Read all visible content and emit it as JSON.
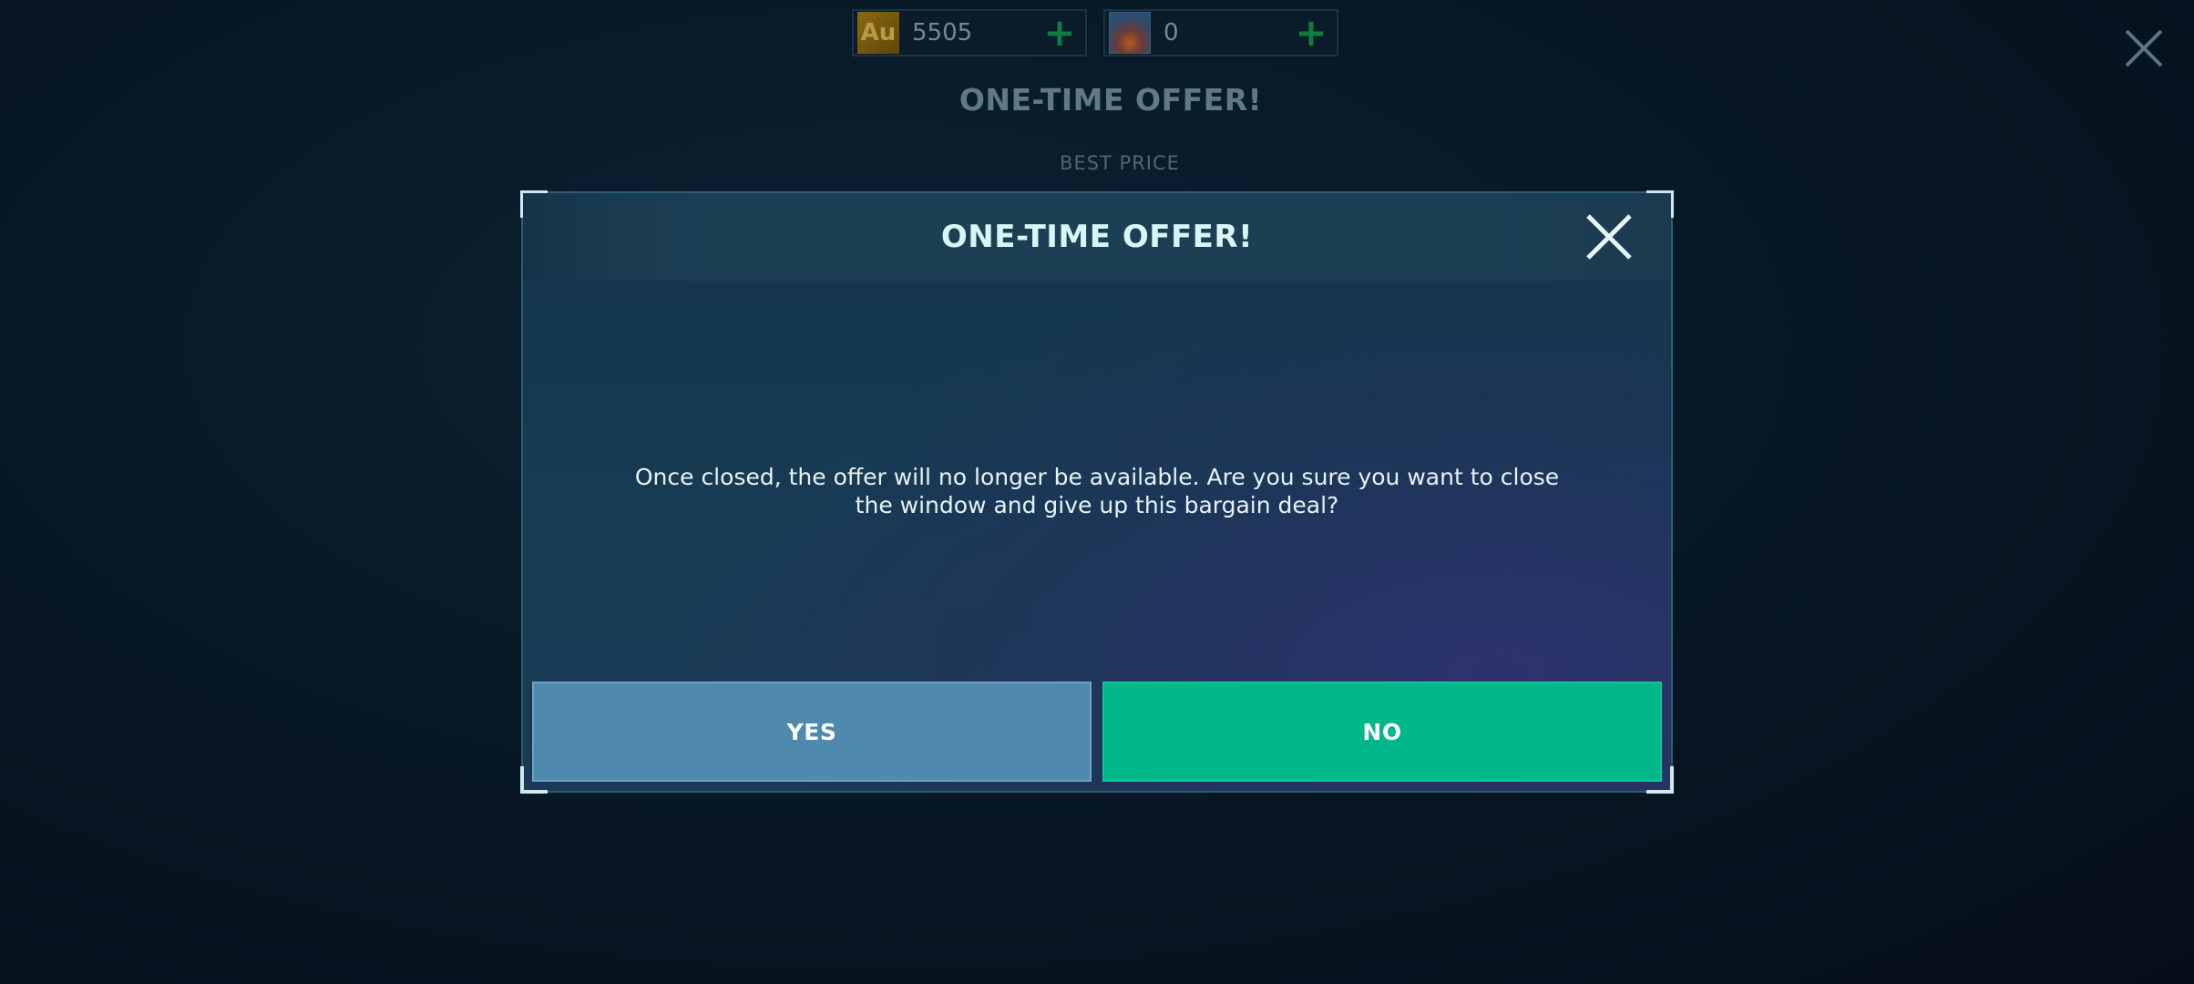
{
  "background": {
    "currencies": [
      {
        "name": "gold",
        "icon": "gold-au-icon",
        "icon_text": "Au",
        "amount": "5505"
      },
      {
        "name": "flame",
        "icon": "flame-crystal-icon",
        "amount": "0"
      }
    ],
    "title": "ONE-TIME OFFER!",
    "subtitle": "BEST PRICE",
    "close_icon": "close-icon"
  },
  "dialog": {
    "title": "ONE-TIME OFFER!",
    "message": "Once closed, the offer will no longer be available. Are you sure you want to close the window and give up this bargain deal?",
    "yes_label": "YES",
    "no_label": "NO",
    "close_icon": "close-icon"
  },
  "colors": {
    "yes_button": "#4f89ad",
    "no_button": "#00b789",
    "title_text": "#d7f6f8",
    "plus_icon": "#0d7e3e"
  }
}
